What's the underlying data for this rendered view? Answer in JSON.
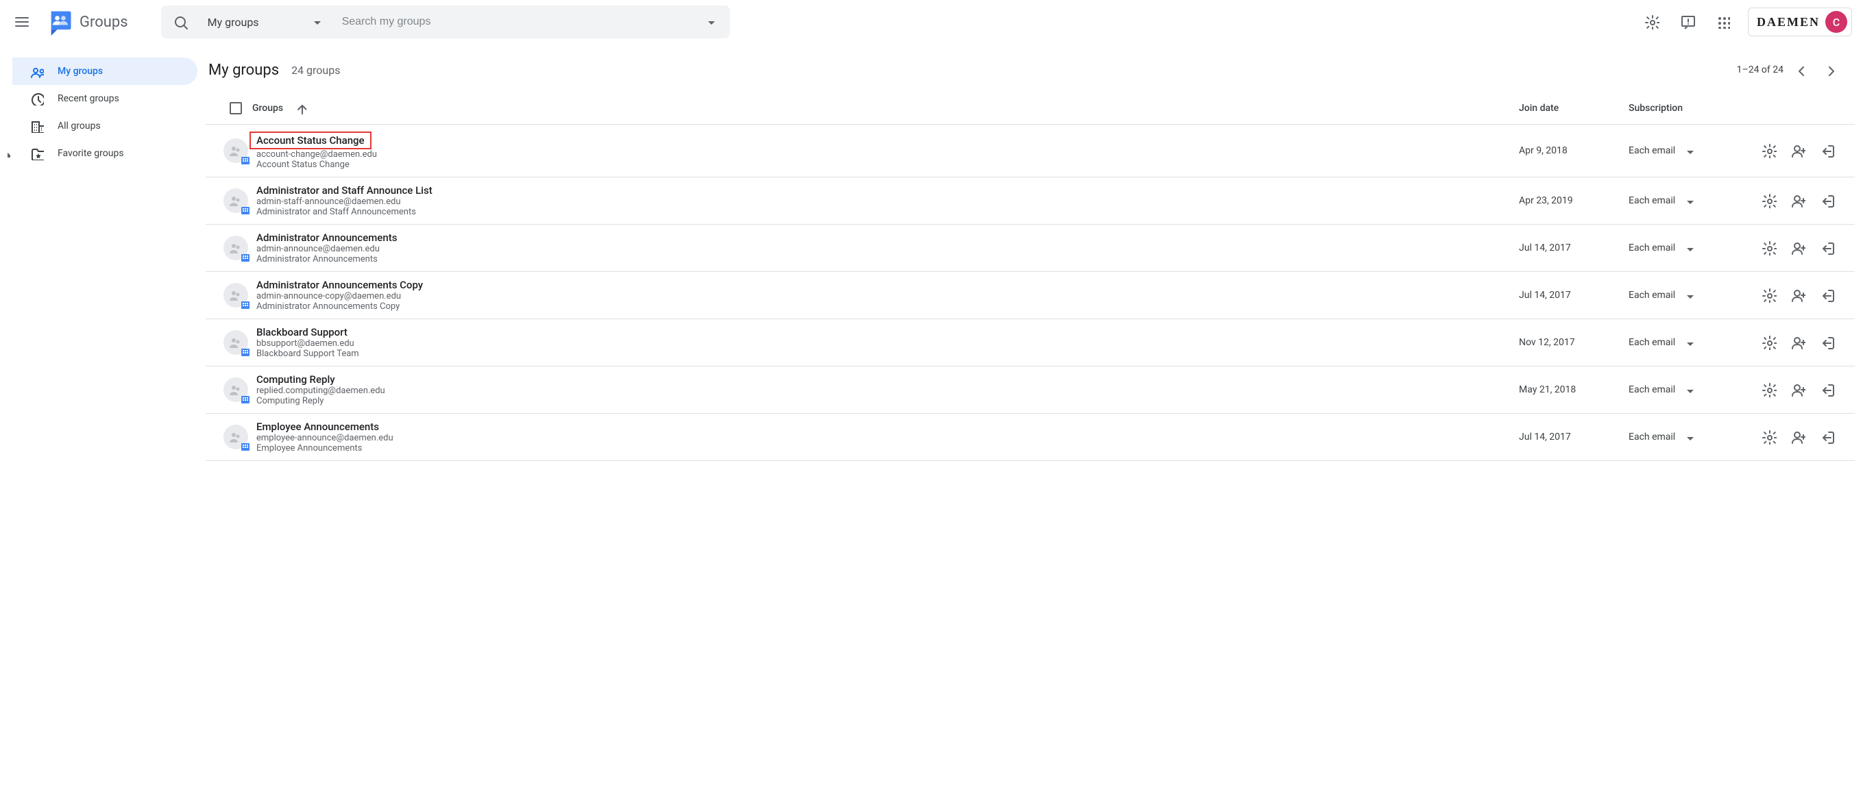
{
  "header": {
    "product_name": "Groups",
    "search_scope": "My groups",
    "search_placeholder": "Search my groups",
    "org_label": "DAEMEN",
    "avatar_initial": "C"
  },
  "sidebar": {
    "items": [
      {
        "label": "My groups",
        "icon": "groups",
        "active": true
      },
      {
        "label": "Recent groups",
        "icon": "clock",
        "active": false
      },
      {
        "label": "All groups",
        "icon": "domain",
        "active": false
      },
      {
        "label": "Favorite groups",
        "icon": "star-folder",
        "active": false,
        "expandable": true
      }
    ]
  },
  "page": {
    "title": "My groups",
    "count_text": "24 groups",
    "pager_text": "1–24 of 24"
  },
  "columns": {
    "groups": "Groups",
    "join": "Join date",
    "subscription": "Subscription"
  },
  "groups": [
    {
      "name": "Account Status Change",
      "email": "account-change@daemen.edu",
      "desc": "Account Status Change",
      "join": "Apr 9, 2018",
      "sub": "Each email",
      "highlight": true
    },
    {
      "name": "Administrator and Staff Announce List",
      "email": "admin-staff-announce@daemen.edu",
      "desc": "Administrator and Staff Announcements",
      "join": "Apr 23, 2019",
      "sub": "Each email",
      "highlight": false
    },
    {
      "name": "Administrator Announcements",
      "email": "admin-announce@daemen.edu",
      "desc": "Administrator Announcements",
      "join": "Jul 14, 2017",
      "sub": "Each email",
      "highlight": false
    },
    {
      "name": "Administrator Announcements Copy",
      "email": "admin-announce-copy@daemen.edu",
      "desc": "Administrator Announcements Copy",
      "join": "Jul 14, 2017",
      "sub": "Each email",
      "highlight": false
    },
    {
      "name": "Blackboard Support",
      "email": "bbsupport@daemen.edu",
      "desc": "Blackboard Support Team",
      "join": "Nov 12, 2017",
      "sub": "Each email",
      "highlight": false
    },
    {
      "name": "Computing Reply",
      "email": "replied.computing@daemen.edu",
      "desc": "Computing Reply",
      "join": "May 21, 2018",
      "sub": "Each email",
      "highlight": false
    },
    {
      "name": "Employee Announcements",
      "email": "employee-announce@daemen.edu",
      "desc": "Employee Announcements",
      "join": "Jul 14, 2017",
      "sub": "Each email",
      "highlight": false
    }
  ]
}
